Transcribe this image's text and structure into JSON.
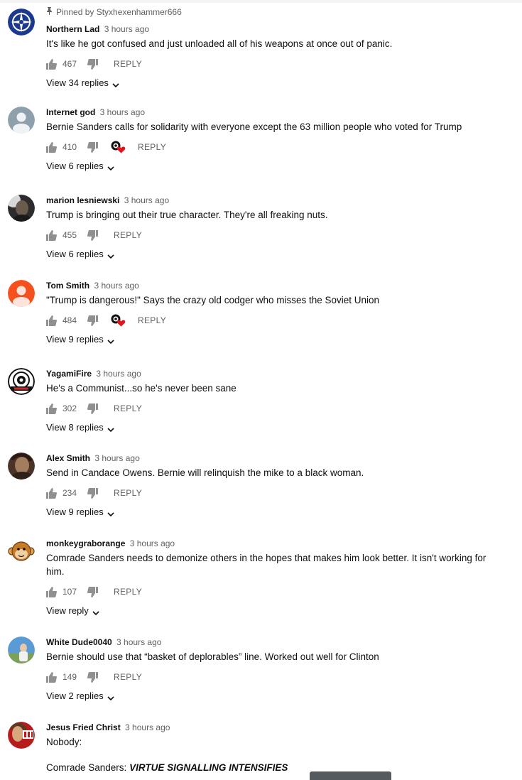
{
  "pinned_label": "Pinned by Styxhexenhammer666",
  "reply_label": "REPLY",
  "icons": {
    "like": "thumb-up-icon",
    "dislike": "thumb-down-icon",
    "creator_heart": "creator-heart-icon",
    "expand": "chevron-down-icon",
    "pin": "pin-icon"
  },
  "colors": {
    "heart": "#e4121b",
    "secondary_text": "#606060",
    "primary_text": "#0f0f0f"
  },
  "comments": [
    {
      "author": "Northern Lad",
      "time": "3 hours ago",
      "text": "It's like he got confused and just unloaded all of his weapons at once out of panic.",
      "likes": "467",
      "hearted": false,
      "view_replies": "View 34 replies",
      "pinned": true,
      "avatar": "compass-avatar"
    },
    {
      "author": "Internet god",
      "time": "3 hours ago",
      "text": "Bernie Sanders calls for solidarity with everyone except the 63 million people who voted for Trump",
      "likes": "410",
      "hearted": true,
      "view_replies": "View 6 replies",
      "avatar": "default-avatar"
    },
    {
      "author": "marion lesniewski",
      "time": "3 hours ago",
      "text": "Trump is bringing out their true character. They're all freaking nuts.",
      "likes": "455",
      "hearted": false,
      "view_replies": "View 6 replies",
      "avatar": "photo-avatar"
    },
    {
      "author": "Tom Smith",
      "time": "3 hours ago",
      "text": "\"Trump is dangerous!\" Says the crazy old codger who misses the Soviet Union",
      "likes": "484",
      "hearted": true,
      "view_replies": "View 9 replies",
      "avatar": "orange-default-avatar"
    },
    {
      "author": "YagamiFire",
      "time": "3 hours ago",
      "text": "He's a Communist...so he's never been sane",
      "likes": "302",
      "hearted": false,
      "view_replies": "View 8 replies",
      "avatar": "sin-logo-avatar"
    },
    {
      "author": "Alex Smith",
      "time": "3 hours ago",
      "text": "Send in Candace Owens. Bernie will relinquish the mike to a black woman.",
      "likes": "234",
      "hearted": false,
      "view_replies": "View 9 replies",
      "avatar": "portrait-avatar"
    },
    {
      "author": "monkeygraborange",
      "time": "3 hours ago",
      "text": "Comrade Sanders needs to demonize others in the hopes that makes him look better. It isn't working for him.",
      "likes": "107",
      "hearted": false,
      "view_replies": "View reply",
      "avatar": "monkey-avatar"
    },
    {
      "author": "White Dude0040",
      "time": "3 hours ago",
      "text": "Bernie should use that “basket of deplorables” line. Worked out well for Clinton",
      "likes": "149",
      "hearted": false,
      "view_replies": "View 2 replies",
      "avatar": "sky-photo-avatar"
    },
    {
      "author": "Jesus Fried Christ",
      "time": "3 hours ago",
      "text": "Nobody:",
      "text2_prefix": "Comrade Sanders: ",
      "text2_emphasis": "VIRTUE SIGNALLING INTENSIFIES",
      "avatar": "jfc-avatar"
    }
  ]
}
